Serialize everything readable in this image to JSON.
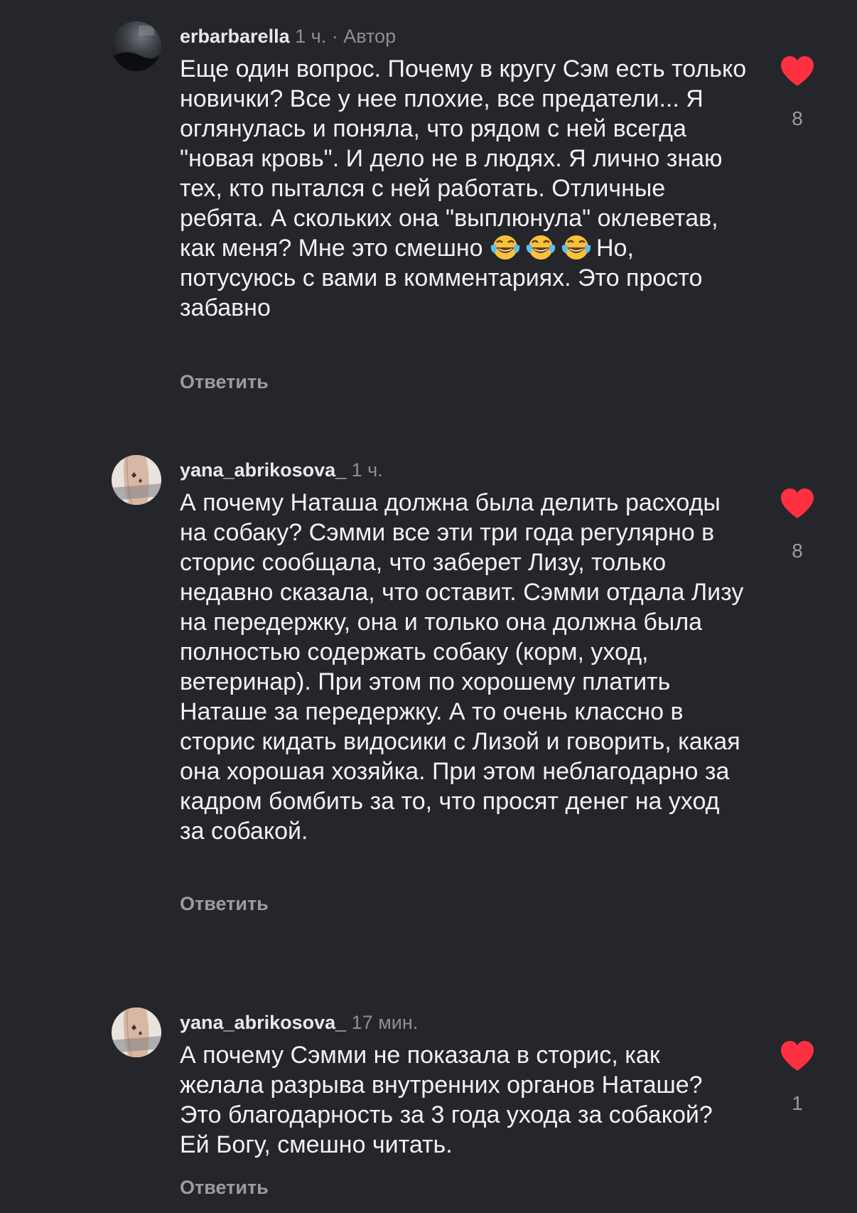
{
  "comments": [
    {
      "username": "erbarbarella",
      "time": "1 ч.",
      "separator": "·",
      "author_badge": "Автор",
      "text_before_emoji": "Еще один вопрос. Почему в кругу Сэм есть только новички? Все у нее плохие, все предатели... Я оглянулась и поняла, что рядом с ней всегда \"новая кровь\". И дело не в людях. Я лично знаю тех, кто пытался с ней работать. Отличные ребята. А скольких она \"выплюнула\" оклеветав, как меня? Мне это смешно ",
      "emoji": [
        "face-with-tears-of-joy",
        "face-with-tears-of-joy",
        "face-with-tears-of-joy"
      ],
      "text_after_emoji": "Но, потусуюсь с вами в комментариях. Это просто забавно",
      "reply_label": "Ответить",
      "like_count": "8",
      "liked": true
    },
    {
      "username": "yana_abrikosova_",
      "time": "1 ч.",
      "text": "А почему Наташа должна была делить расходы на собаку? Сэмми все эти три года регулярно в сторис сообщала, что заберет Лизу, только недавно сказала, что оставит. Сэмми отдала Лизу на передержку, она и только она должна была полностью содержать собаку (корм, уход, ветеринар). При этом по хорошему платить Наташе за передержку. А то очень классно в сторис кидать видосики с Лизой и говорить, какая она хорошая хозяйка. При этом неблагодарно за кадром бомбить за то, что просят денег на уход за собакой.",
      "reply_label": "Ответить",
      "like_count": "8",
      "liked": true
    },
    {
      "username": "yana_abrikosova_",
      "time": "17 мин.",
      "text": "А почему Сэмми не показала в сторис, как желала разрыва внутренних органов Наташе? Это благодарность за 3 года ухода за собакой? Ей Богу, смешно читать.",
      "reply_label": "Ответить",
      "like_count": "1",
      "liked": true
    }
  ],
  "colors": {
    "background": "#25262b",
    "text": "#f2f2f3",
    "secondary": "#8e8f94",
    "like_red": "#ff3040"
  }
}
